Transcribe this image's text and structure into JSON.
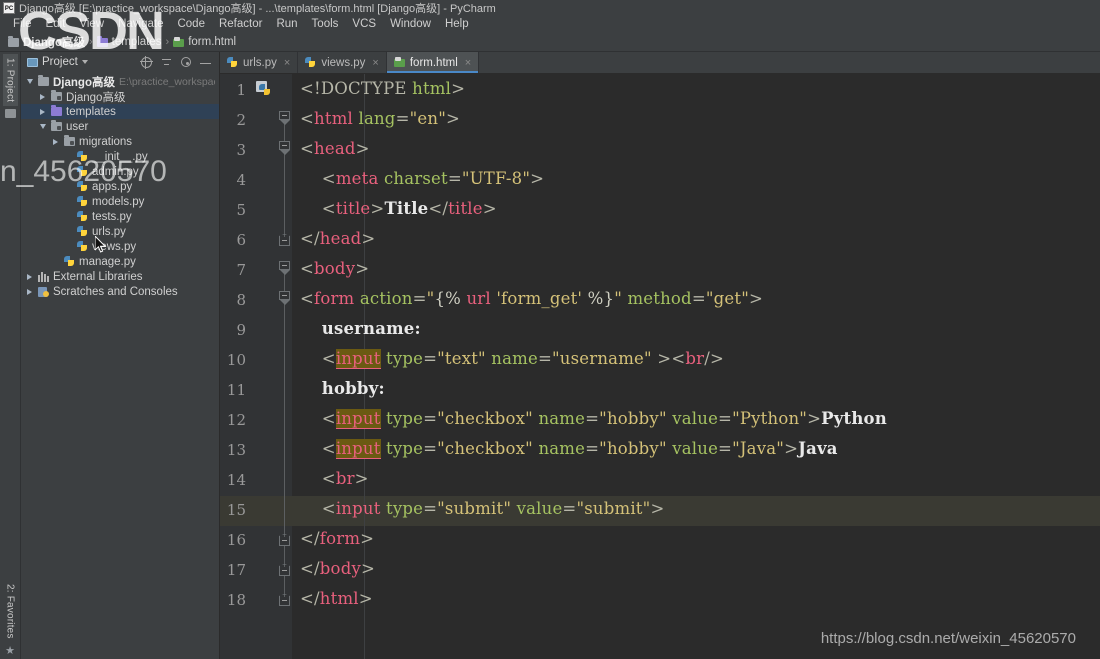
{
  "window": {
    "title": "Django高级 [E:\\practice_workspace\\Django高级] - ...\\templates\\form.html [Django高级] - PyCharm",
    "app_icon": "pycharm-logo-icon",
    "logo_text": "PC"
  },
  "menubar": {
    "items": [
      {
        "label": "File"
      },
      {
        "label": "Edit"
      },
      {
        "label": "View"
      },
      {
        "label": "Navigate"
      },
      {
        "label": "Code"
      },
      {
        "label": "Refactor"
      },
      {
        "label": "Run"
      },
      {
        "label": "Tools"
      },
      {
        "label": "VCS"
      },
      {
        "label": "Window"
      },
      {
        "label": "Help"
      }
    ]
  },
  "breadcrumb": {
    "separator": "›",
    "items": [
      {
        "label": "Django高级",
        "icon": "folder-icon"
      },
      {
        "label": "templates",
        "icon": "folder-purple-icon"
      },
      {
        "label": "form.html",
        "icon": "html-file-icon"
      }
    ]
  },
  "toolstrip": {
    "top_tab": "1: Project",
    "bottom_tab": "2: Favorites",
    "star_icon": "star-icon"
  },
  "project_panel": {
    "title": "Project",
    "title_icon": "project-window-icon",
    "dropdown_icon": "chevron-down-icon",
    "actions": [
      {
        "name": "locate-icon",
        "title": "Select Opened File"
      },
      {
        "name": "collapse-all-icon",
        "title": "Collapse All"
      },
      {
        "name": "gear-icon",
        "title": "Settings"
      },
      {
        "name": "minimize-icon",
        "title": "Hide"
      }
    ],
    "tree": [
      {
        "label": "Django高级",
        "sub": "E:\\practice_workspace\\Django高级",
        "indent": 0,
        "arrow": "down",
        "icon": "folder-root-icon",
        "bold": true,
        "selected": false
      },
      {
        "label": "Django高级",
        "sub": "",
        "indent": 1,
        "arrow": "right",
        "icon": "folder-module-icon",
        "bold": false,
        "selected": false
      },
      {
        "label": "templates",
        "sub": "",
        "indent": 1,
        "arrow": "right",
        "icon": "folder-purple-icon",
        "bold": false,
        "selected": true
      },
      {
        "label": "user",
        "sub": "",
        "indent": 1,
        "arrow": "down",
        "icon": "folder-module-icon",
        "bold": false,
        "selected": false
      },
      {
        "label": "migrations",
        "sub": "",
        "indent": 2,
        "arrow": "right",
        "icon": "folder-module-icon",
        "bold": false,
        "selected": false
      },
      {
        "label": "__init__.py",
        "sub": "",
        "indent": 3,
        "arrow": "none",
        "icon": "python-file-icon",
        "bold": false,
        "selected": false
      },
      {
        "label": "admin.py",
        "sub": "",
        "indent": 3,
        "arrow": "none",
        "icon": "python-file-icon",
        "bold": false,
        "selected": false
      },
      {
        "label": "apps.py",
        "sub": "",
        "indent": 3,
        "arrow": "none",
        "icon": "python-file-icon",
        "bold": false,
        "selected": false
      },
      {
        "label": "models.py",
        "sub": "",
        "indent": 3,
        "arrow": "none",
        "icon": "python-file-icon",
        "bold": false,
        "selected": false
      },
      {
        "label": "tests.py",
        "sub": "",
        "indent": 3,
        "arrow": "none",
        "icon": "python-file-icon",
        "bold": false,
        "selected": false
      },
      {
        "label": "urls.py",
        "sub": "",
        "indent": 3,
        "arrow": "none",
        "icon": "python-file-icon",
        "bold": false,
        "selected": false
      },
      {
        "label": "views.py",
        "sub": "",
        "indent": 3,
        "arrow": "none",
        "icon": "python-file-icon",
        "bold": false,
        "selected": false
      },
      {
        "label": "manage.py",
        "sub": "",
        "indent": 2,
        "arrow": "none",
        "icon": "python-file-icon",
        "bold": false,
        "selected": false
      },
      {
        "label": "External Libraries",
        "sub": "",
        "indent": 0,
        "arrow": "right",
        "icon": "libraries-icon",
        "bold": false,
        "selected": false
      },
      {
        "label": "Scratches and Consoles",
        "sub": "",
        "indent": 0,
        "arrow": "right",
        "icon": "scratches-icon",
        "bold": false,
        "selected": false
      }
    ]
  },
  "editor": {
    "tabs": [
      {
        "label": "urls.py",
        "icon": "python-file-icon",
        "active": false,
        "close_icon": "close-icon"
      },
      {
        "label": "views.py",
        "icon": "python-file-icon",
        "active": false,
        "close_icon": "close-icon"
      },
      {
        "label": "form.html",
        "icon": "html-file-icon",
        "active": true,
        "close_icon": "close-icon"
      }
    ],
    "current_line": 15,
    "gutter_icon_line": 1,
    "gutter_icon": "python-run-icon",
    "lines": [
      {
        "n": 1,
        "tokens": [
          {
            "t": "<!DOCTYPE ",
            "c": "punct"
          },
          {
            "t": "html",
            "c": "attr"
          },
          {
            "t": ">",
            "c": "punct"
          }
        ]
      },
      {
        "n": 2,
        "tokens": [
          {
            "t": "<",
            "c": "punct"
          },
          {
            "t": "html",
            "c": "tag"
          },
          {
            "t": " ",
            "c": "punct"
          },
          {
            "t": "lang",
            "c": "attr"
          },
          {
            "t": "=",
            "c": "punct"
          },
          {
            "t": "\"en\"",
            "c": "val"
          },
          {
            "t": ">",
            "c": "punct"
          }
        ]
      },
      {
        "n": 3,
        "tokens": [
          {
            "t": "<",
            "c": "punct"
          },
          {
            "t": "head",
            "c": "tag"
          },
          {
            "t": ">",
            "c": "punct"
          }
        ]
      },
      {
        "n": 4,
        "tokens": [
          {
            "t": "    <",
            "c": "punct"
          },
          {
            "t": "meta",
            "c": "tag"
          },
          {
            "t": " ",
            "c": "punct"
          },
          {
            "t": "charset",
            "c": "attr"
          },
          {
            "t": "=",
            "c": "punct"
          },
          {
            "t": "\"UTF-8\"",
            "c": "val"
          },
          {
            "t": ">",
            "c": "punct"
          }
        ]
      },
      {
        "n": 5,
        "tokens": [
          {
            "t": "    <",
            "c": "punct"
          },
          {
            "t": "title",
            "c": "tag"
          },
          {
            "t": ">",
            "c": "punct"
          },
          {
            "t": "Title",
            "c": "txt"
          },
          {
            "t": "</",
            "c": "punct"
          },
          {
            "t": "title",
            "c": "tag"
          },
          {
            "t": ">",
            "c": "punct"
          }
        ]
      },
      {
        "n": 6,
        "tokens": [
          {
            "t": "</",
            "c": "punct"
          },
          {
            "t": "head",
            "c": "tag"
          },
          {
            "t": ">",
            "c": "punct"
          }
        ]
      },
      {
        "n": 7,
        "tokens": [
          {
            "t": "<",
            "c": "punct"
          },
          {
            "t": "body",
            "c": "tag"
          },
          {
            "t": ">",
            "c": "punct"
          }
        ]
      },
      {
        "n": 8,
        "tokens": [
          {
            "t": "<",
            "c": "punct"
          },
          {
            "t": "form",
            "c": "tag"
          },
          {
            "t": " ",
            "c": "punct"
          },
          {
            "t": "action",
            "c": "attr"
          },
          {
            "t": "=",
            "c": "punct"
          },
          {
            "t": "\"",
            "c": "val"
          },
          {
            "t": "{% ",
            "c": "dj"
          },
          {
            "t": "url",
            "c": "djtag"
          },
          {
            "t": " 'form_get' ",
            "c": "djstr"
          },
          {
            "t": "%}",
            "c": "dj"
          },
          {
            "t": "\"",
            "c": "val"
          },
          {
            "t": " ",
            "c": "punct"
          },
          {
            "t": "method",
            "c": "attr"
          },
          {
            "t": "=",
            "c": "punct"
          },
          {
            "t": "\"get\"",
            "c": "val"
          },
          {
            "t": ">",
            "c": "punct"
          }
        ]
      },
      {
        "n": 9,
        "tokens": [
          {
            "t": "    ",
            "c": "punct"
          },
          {
            "t": "username:",
            "c": "txt"
          }
        ]
      },
      {
        "n": 10,
        "tokens": [
          {
            "t": "    <",
            "c": "punct"
          },
          {
            "t": "input",
            "c": "hl"
          },
          {
            "t": " ",
            "c": "punct"
          },
          {
            "t": "type",
            "c": "attr"
          },
          {
            "t": "=",
            "c": "punct"
          },
          {
            "t": "\"text\"",
            "c": "val"
          },
          {
            "t": " ",
            "c": "punct"
          },
          {
            "t": "name",
            "c": "attr"
          },
          {
            "t": "=",
            "c": "punct"
          },
          {
            "t": "\"username\"",
            "c": "val"
          },
          {
            "t": " >",
            "c": "punct"
          },
          {
            "t": "<",
            "c": "punct"
          },
          {
            "t": "br",
            "c": "tag"
          },
          {
            "t": "/>",
            "c": "punct"
          }
        ]
      },
      {
        "n": 11,
        "tokens": [
          {
            "t": "    ",
            "c": "punct"
          },
          {
            "t": "hobby:",
            "c": "txt"
          }
        ]
      },
      {
        "n": 12,
        "tokens": [
          {
            "t": "    <",
            "c": "punct"
          },
          {
            "t": "input",
            "c": "hl"
          },
          {
            "t": " ",
            "c": "punct"
          },
          {
            "t": "type",
            "c": "attr"
          },
          {
            "t": "=",
            "c": "punct"
          },
          {
            "t": "\"checkbox\"",
            "c": "val"
          },
          {
            "t": " ",
            "c": "punct"
          },
          {
            "t": "name",
            "c": "attr"
          },
          {
            "t": "=",
            "c": "punct"
          },
          {
            "t": "\"hobby\"",
            "c": "val"
          },
          {
            "t": " ",
            "c": "punct"
          },
          {
            "t": "value",
            "c": "attr"
          },
          {
            "t": "=",
            "c": "punct"
          },
          {
            "t": "\"Python\"",
            "c": "val"
          },
          {
            "t": ">",
            "c": "punct"
          },
          {
            "t": "Python",
            "c": "txt"
          }
        ]
      },
      {
        "n": 13,
        "tokens": [
          {
            "t": "    <",
            "c": "punct"
          },
          {
            "t": "input",
            "c": "hl"
          },
          {
            "t": " ",
            "c": "punct"
          },
          {
            "t": "type",
            "c": "attr"
          },
          {
            "t": "=",
            "c": "punct"
          },
          {
            "t": "\"checkbox\"",
            "c": "val"
          },
          {
            "t": " ",
            "c": "punct"
          },
          {
            "t": "name",
            "c": "attr"
          },
          {
            "t": "=",
            "c": "punct"
          },
          {
            "t": "\"hobby\"",
            "c": "val"
          },
          {
            "t": " ",
            "c": "punct"
          },
          {
            "t": "value",
            "c": "attr"
          },
          {
            "t": "=",
            "c": "punct"
          },
          {
            "t": "\"Java\"",
            "c": "val"
          },
          {
            "t": ">",
            "c": "punct"
          },
          {
            "t": "Java",
            "c": "txt"
          }
        ]
      },
      {
        "n": 14,
        "tokens": [
          {
            "t": "    <",
            "c": "punct"
          },
          {
            "t": "br",
            "c": "tag"
          },
          {
            "t": ">",
            "c": "punct"
          }
        ]
      },
      {
        "n": 15,
        "tokens": [
          {
            "t": "    <",
            "c": "punct"
          },
          {
            "t": "input",
            "c": "tag"
          },
          {
            "t": " ",
            "c": "punct"
          },
          {
            "t": "type",
            "c": "attr"
          },
          {
            "t": "=",
            "c": "punct"
          },
          {
            "t": "\"submit\"",
            "c": "val"
          },
          {
            "t": " ",
            "c": "punct"
          },
          {
            "t": "value",
            "c": "attr"
          },
          {
            "t": "=",
            "c": "punct"
          },
          {
            "t": "\"submit\"",
            "c": "val"
          },
          {
            "t": ">",
            "c": "punct"
          }
        ]
      },
      {
        "n": 16,
        "tokens": [
          {
            "t": "</",
            "c": "punct"
          },
          {
            "t": "form",
            "c": "tag"
          },
          {
            "t": ">",
            "c": "punct"
          }
        ]
      },
      {
        "n": 17,
        "tokens": [
          {
            "t": "</",
            "c": "punct"
          },
          {
            "t": "body",
            "c": "tag"
          },
          {
            "t": ">",
            "c": "punct"
          }
        ]
      },
      {
        "n": 18,
        "tokens": [
          {
            "t": "</",
            "c": "punct"
          },
          {
            "t": "html",
            "c": "tag"
          },
          {
            "t": ">",
            "c": "punct"
          }
        ]
      }
    ]
  },
  "watermarks": {
    "brand": "CSDN",
    "user_id": "n_45620570",
    "url": "https://blog.csdn.net/weixin_45620570"
  },
  "colors": {
    "panel_bg": "#3c3f41",
    "editor_bg": "#2b2b2b",
    "gutter_bg": "#313335",
    "selection": "#2f4156",
    "current_line": "#3a3a33",
    "tag": "#e8607d",
    "attr": "#a5c261",
    "value": "#d4c178",
    "highlight": "#6b5a12"
  }
}
